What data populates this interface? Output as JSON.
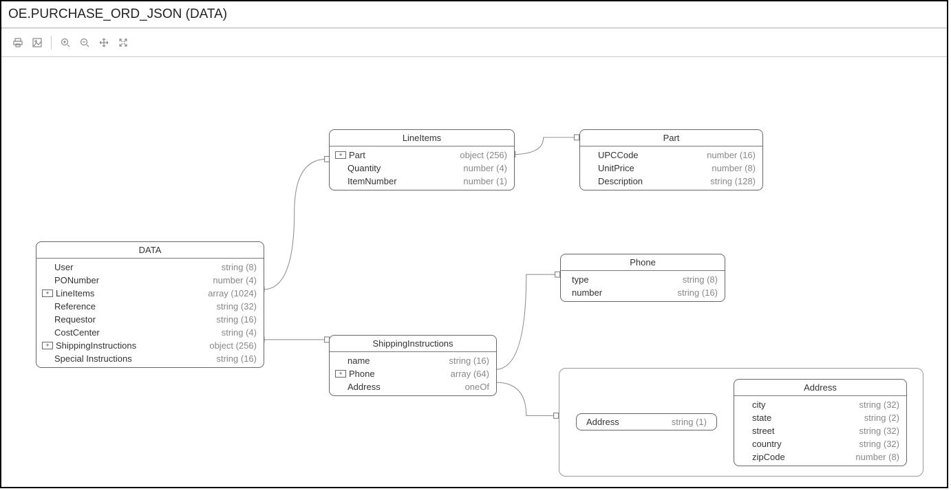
{
  "title": "OE.PURCHASE_ORD_JSON (DATA)",
  "toolbar": {
    "print": "print-icon",
    "image": "image-icon",
    "zoom_in": "zoom-in-icon",
    "zoom_out": "zoom-out-icon",
    "fit": "fit-icon",
    "expand": "expand-icon"
  },
  "entities": {
    "data": {
      "title": "DATA",
      "user": {
        "name": "User",
        "type": "string (8)"
      },
      "ponumber": {
        "name": "PONumber",
        "type": "number (4)"
      },
      "lineitems": {
        "name": "LineItems",
        "type": "array (1024)"
      },
      "reference": {
        "name": "Reference",
        "type": "string (32)"
      },
      "requestor": {
        "name": "Requestor",
        "type": "string (16)"
      },
      "costcenter": {
        "name": "CostCenter",
        "type": "string (4)"
      },
      "shipping": {
        "name": "ShippingInstructions",
        "type": "object (256)"
      },
      "special": {
        "name": "Special Instructions",
        "type": "string (16)"
      }
    },
    "lineitems": {
      "title": "LineItems",
      "part": {
        "name": "Part",
        "type": "object (256)"
      },
      "quantity": {
        "name": "Quantity",
        "type": "number (4)"
      },
      "itemnumber": {
        "name": "ItemNumber",
        "type": "number (1)"
      }
    },
    "part": {
      "title": "Part",
      "upc": {
        "name": "UPCCode",
        "type": "number (16)"
      },
      "unitprice": {
        "name": "UnitPrice",
        "type": "number (8)"
      },
      "description": {
        "name": "Description",
        "type": "string (128)"
      }
    },
    "shipping": {
      "title": "ShippingInstructions",
      "name": {
        "name": "name",
        "type": "string (16)"
      },
      "phone": {
        "name": "Phone",
        "type": "array (64)"
      },
      "address": {
        "name": "Address",
        "type": "oneOf"
      }
    },
    "phone": {
      "title": "Phone",
      "type": {
        "name": "type",
        "type": "string (8)"
      },
      "number": {
        "name": "number",
        "type": "string (16)"
      }
    },
    "addressMini": {
      "name": "Address",
      "type": "string (1)"
    },
    "address": {
      "title": "Address",
      "city": {
        "name": "city",
        "type": "string (32)"
      },
      "state": {
        "name": "state",
        "type": "string (2)"
      },
      "street": {
        "name": "street",
        "type": "string (32)"
      },
      "country": {
        "name": "country",
        "type": "string (32)"
      },
      "zipcode": {
        "name": "zipCode",
        "type": "number (8)"
      }
    }
  }
}
